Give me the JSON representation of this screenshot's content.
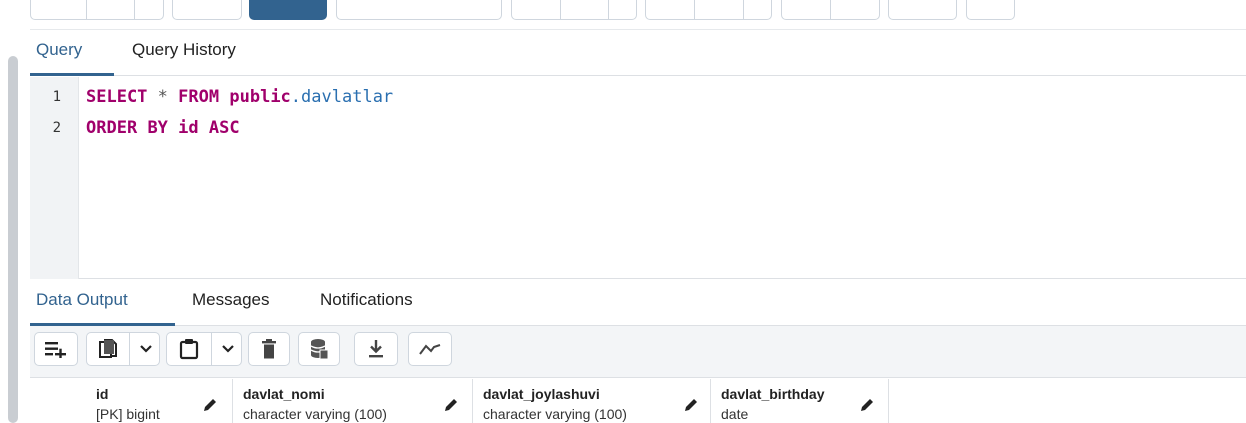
{
  "query_tabs": {
    "items": [
      {
        "label": "Query",
        "active": true
      },
      {
        "label": "Query History",
        "active": false
      }
    ]
  },
  "editor": {
    "lines": [
      {
        "number": "1",
        "tokens": {
          "k1": "SELECT",
          "star": "*",
          "k2": "FROM",
          "schema": "public",
          "dot": ".",
          "table": "davlatlar"
        }
      },
      {
        "number": "2",
        "tokens": {
          "k1": "ORDER",
          "k2": "BY",
          "k3": "id",
          "k4": "ASC"
        }
      }
    ]
  },
  "result_tabs": {
    "items": [
      {
        "label": "Data Output",
        "active": true
      },
      {
        "label": "Messages",
        "active": false
      },
      {
        "label": "Notifications",
        "active": false
      }
    ]
  },
  "data_toolbar": {
    "icons": [
      "add-row-icon",
      "copy-icon",
      "chevron-down-icon",
      "paste-icon",
      "chevron-down-icon",
      "delete-icon",
      "save-data-icon",
      "download-icon",
      "graph-icon"
    ]
  },
  "grid": {
    "columns": [
      {
        "name": "id",
        "type": "[PK] bigint"
      },
      {
        "name": "davlat_nomi",
        "type": "character varying (100)"
      },
      {
        "name": "davlat_joylashuvi",
        "type": "character varying (100)"
      },
      {
        "name": "davlat_birthday",
        "type": "date"
      }
    ]
  },
  "colors": {
    "accent": "#32638f",
    "keyword": "#a0006b",
    "identifier": "#2a6fb0"
  }
}
